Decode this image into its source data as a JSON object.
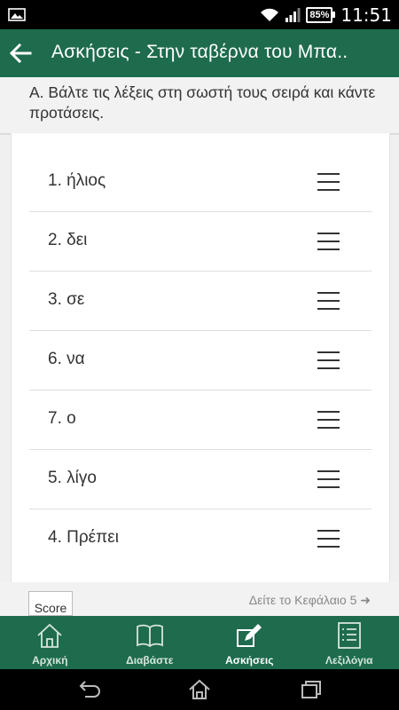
{
  "status_bar": {
    "battery": "85%",
    "time": "11:51"
  },
  "app_bar": {
    "title": "Ασκήσεις - Στην ταβέρνα του Μπα.."
  },
  "instruction": "Α. Βάλτε τις λέξεις στη σωστή τους σειρά και κάντε προτάσεις.",
  "items": [
    {
      "label": "1. ήλιος"
    },
    {
      "label": "2. δει"
    },
    {
      "label": "3. σε"
    },
    {
      "label": "6. να"
    },
    {
      "label": "7. ο"
    },
    {
      "label": "5. λίγο"
    },
    {
      "label": "4. Πρέπει"
    }
  ],
  "score_button": "Score",
  "chapter_link": "Δείτε το Κεφάλαιο 5 ➜",
  "bottom_nav": [
    {
      "label": "Αρχική",
      "icon": "home-icon",
      "active": false
    },
    {
      "label": "Διαβάστε",
      "icon": "book-icon",
      "active": false
    },
    {
      "label": "Ασκήσεις",
      "icon": "pencil-icon",
      "active": true
    },
    {
      "label": "Λεξιλόγια",
      "icon": "list-icon",
      "active": false
    }
  ],
  "colors": {
    "primary": "#1e6b4e",
    "nav_text": "#d6e5dd"
  }
}
